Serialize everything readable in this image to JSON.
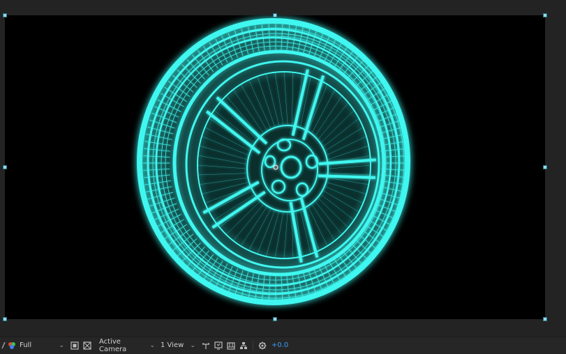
{
  "viewer": {
    "name": "composition-viewer",
    "render_color": "#3ff7f0"
  },
  "toolbar": {
    "resolution": "Full",
    "camera": "Active Camera",
    "views": "1 View",
    "exposure": "+0.0",
    "exposure_color": "#3d9bf5"
  },
  "icons": [
    "pen-icon",
    "color-picker-icon",
    "chevron-down-icon",
    "region-of-interest-icon",
    "transparency-grid-icon",
    "chevron-down-icon",
    "chevron-down-icon",
    "3d-axis-icon",
    "fast-preview-icon",
    "timeline-icon",
    "flowchart-icon",
    "reset-exposure-icon"
  ]
}
